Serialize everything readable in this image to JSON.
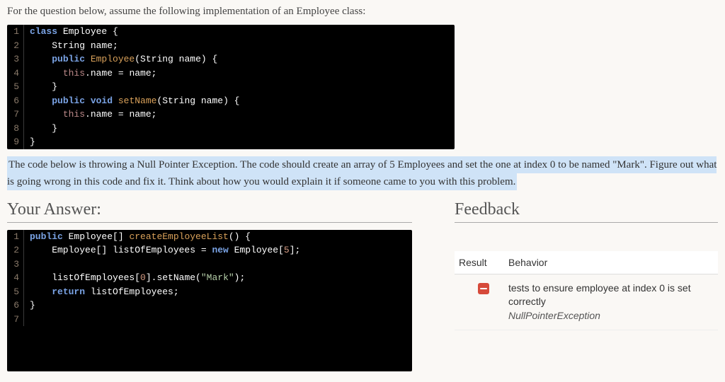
{
  "intro": "For the question below, assume the following implementation of an Employee class:",
  "code_top": [
    {
      "n": "1",
      "tokens": [
        {
          "t": "class ",
          "c": "kw"
        },
        {
          "t": "Employee",
          "c": "type"
        },
        {
          "t": " {",
          "c": ""
        }
      ]
    },
    {
      "n": "2",
      "tokens": [
        {
          "t": "    String name;",
          "c": ""
        }
      ]
    },
    {
      "n": "3",
      "tokens": [
        {
          "t": "    ",
          "c": ""
        },
        {
          "t": "public ",
          "c": "kw"
        },
        {
          "t": "Employee",
          "c": "method"
        },
        {
          "t": "(String name) {",
          "c": ""
        }
      ]
    },
    {
      "n": "4",
      "tokens": [
        {
          "t": "      ",
          "c": ""
        },
        {
          "t": "this",
          "c": "this"
        },
        {
          "t": ".name = name;",
          "c": ""
        }
      ]
    },
    {
      "n": "5",
      "tokens": [
        {
          "t": "    }",
          "c": ""
        }
      ]
    },
    {
      "n": "6",
      "tokens": [
        {
          "t": "    ",
          "c": ""
        },
        {
          "t": "public void ",
          "c": "kw"
        },
        {
          "t": "setName",
          "c": "method"
        },
        {
          "t": "(String name) {",
          "c": ""
        }
      ]
    },
    {
      "n": "7",
      "tokens": [
        {
          "t": "      ",
          "c": ""
        },
        {
          "t": "this",
          "c": "this"
        },
        {
          "t": ".name = name;",
          "c": ""
        }
      ]
    },
    {
      "n": "8",
      "tokens": [
        {
          "t": "    }",
          "c": ""
        }
      ]
    },
    {
      "n": "9",
      "tokens": [
        {
          "t": "}",
          "c": ""
        }
      ]
    }
  ],
  "highlight": "The code below is throwing a Null Pointer Exception. The code should create an array of 5 Employees and set the one at index 0 to be named \"Mark\". Figure out what is going wrong in this code and fix it. Think about how you would explain it if someone came to you with this problem.",
  "answer_heading": "Your Answer:",
  "feedback_heading": "Feedback",
  "code_answer": [
    {
      "n": "1",
      "tokens": [
        {
          "t": "public ",
          "c": "kw"
        },
        {
          "t": "Employee",
          "c": "type"
        },
        {
          "t": "[] ",
          "c": ""
        },
        {
          "t": "createEmployeeList",
          "c": "method"
        },
        {
          "t": "() {",
          "c": ""
        }
      ]
    },
    {
      "n": "2",
      "tokens": [
        {
          "t": "    Employee[] listOfEmployees = ",
          "c": ""
        },
        {
          "t": "new ",
          "c": "new"
        },
        {
          "t": "Employee[",
          "c": ""
        },
        {
          "t": "5",
          "c": "num"
        },
        {
          "t": "];",
          "c": ""
        }
      ]
    },
    {
      "n": "3",
      "tokens": [
        {
          "t": "",
          "c": ""
        }
      ]
    },
    {
      "n": "4",
      "tokens": [
        {
          "t": "    listOfEmployees[",
          "c": ""
        },
        {
          "t": "0",
          "c": "num"
        },
        {
          "t": "].setName(",
          "c": ""
        },
        {
          "t": "\"Mark\"",
          "c": "str"
        },
        {
          "t": ");",
          "c": ""
        }
      ]
    },
    {
      "n": "5",
      "tokens": [
        {
          "t": "    ",
          "c": ""
        },
        {
          "t": "return ",
          "c": "kw"
        },
        {
          "t": "listOfEmployees;",
          "c": ""
        }
      ]
    },
    {
      "n": "6",
      "tokens": [
        {
          "t": "}",
          "c": ""
        }
      ]
    },
    {
      "n": "7",
      "tokens": [
        {
          "t": "",
          "c": ""
        }
      ]
    }
  ],
  "feedback": {
    "header_result": "Result",
    "header_behavior": "Behavior",
    "rows": [
      {
        "status": "fail",
        "behavior": "tests to ensure employee at index 0 is set correctly",
        "exception": "NullPointerException"
      }
    ]
  }
}
